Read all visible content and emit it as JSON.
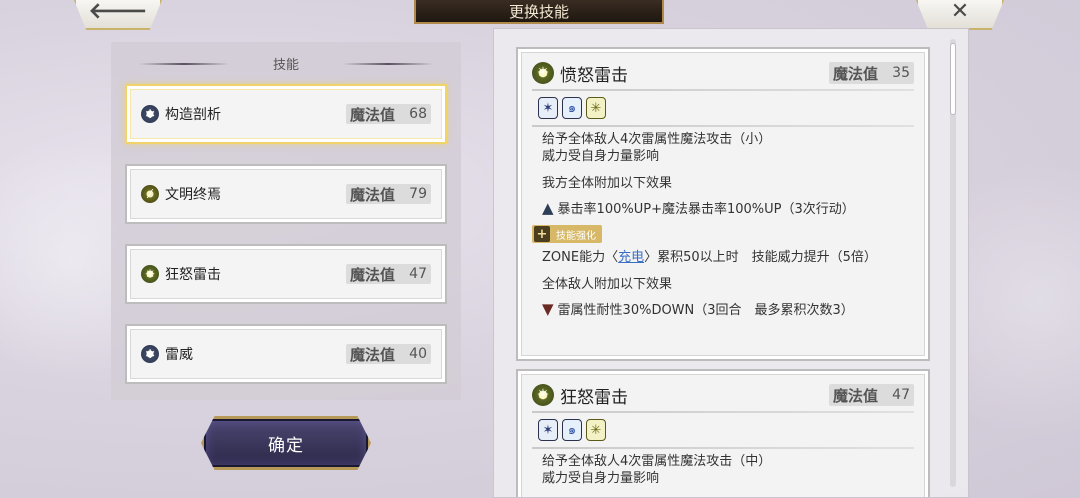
{
  "header": {
    "title": "更换技能",
    "back_icon": "back-arrow-icon",
    "close_icon": "close-icon",
    "back_glyph": "🡐",
    "close_glyph": "✕"
  },
  "left_panel": {
    "header_label": "技能",
    "skills": [
      {
        "name": "构造剖析",
        "mp_label": "魔法值",
        "mp": "68",
        "icon": "gear-icon",
        "selected": true
      },
      {
        "name": "文明终焉",
        "mp_label": "魔法值",
        "mp": "79",
        "icon": "leaf-icon",
        "selected": false
      },
      {
        "name": "狂怒雷击",
        "mp_label": "魔法值",
        "mp": "47",
        "icon": "thunder-icon",
        "selected": false
      },
      {
        "name": "雷威",
        "mp_label": "魔法值",
        "mp": "40",
        "icon": "gear-icon",
        "selected": false
      }
    ],
    "confirm_label": "确定"
  },
  "right_panel": {
    "cards": [
      {
        "title": "愤怒雷击",
        "mp_label": "魔法值",
        "mp": "35",
        "badges": [
          "all-target-icon",
          "magic-attack-icon",
          "thunder-element-icon"
        ],
        "desc_line1": "给予全体敌人4次雷属性魔法攻击（小）",
        "desc_line2": "威力受自身力量影响",
        "ally_effect_title": "我方全体附加以下效果",
        "ally_effect": "暴击率100%UP+魔法暴击率100%UP（3次行动）",
        "enhance_tag": "技能强化",
        "zone_prefix": "ZONE能力〈",
        "zone_link": "充电",
        "zone_suffix": "〉累积50以上时　技能威力提升（5倍）",
        "enemy_effect_title": "全体敌人附加以下效果",
        "enemy_effect": "雷属性耐性30%DOWN（3回合　最多累积次数3）"
      },
      {
        "title": "狂怒雷击",
        "mp_label": "魔法值",
        "mp": "47",
        "badges": [
          "all-target-icon",
          "magic-attack-icon",
          "thunder-element-icon"
        ],
        "desc_line1": "给予全体敌人4次雷属性魔法攻击（中）",
        "desc_line2": "威力受自身力量影响"
      }
    ]
  },
  "colors": {
    "selected_border": "#f0d46a",
    "confirm_bg": "#2c2848",
    "enhance_tag": "#d6b866",
    "link": "#3a6fc6"
  }
}
